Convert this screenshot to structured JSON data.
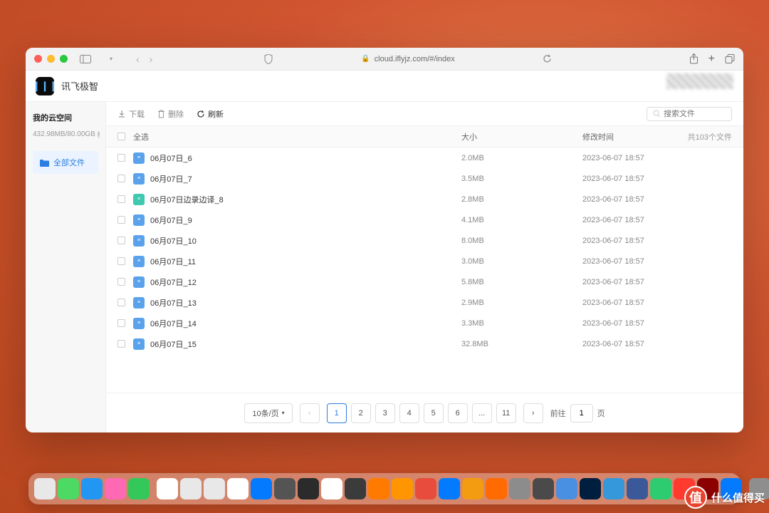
{
  "browser": {
    "url": "cloud.iflyjz.com/#/index"
  },
  "app": {
    "title": "讯飞极智"
  },
  "sidebar": {
    "title": "我的云空间",
    "storage": "432.98MB/80.00GB",
    "item_all": "全部文件"
  },
  "toolbar": {
    "download": "下载",
    "delete": "删除",
    "refresh": "刷新",
    "search_placeholder": "搜索文件"
  },
  "table": {
    "select_all": "全选",
    "size": "大小",
    "mtime": "修改时间",
    "total": "共103个文件"
  },
  "files": [
    {
      "name": "06月07日_6",
      "size": "2.0MB",
      "time": "2023-06-07 18:57",
      "alt": false
    },
    {
      "name": "06月07日_7",
      "size": "3.5MB",
      "time": "2023-06-07 18:57",
      "alt": false
    },
    {
      "name": "06月07日边录边译_8",
      "size": "2.8MB",
      "time": "2023-06-07 18:57",
      "alt": true
    },
    {
      "name": "06月07日_9",
      "size": "4.1MB",
      "time": "2023-06-07 18:57",
      "alt": false
    },
    {
      "name": "06月07日_10",
      "size": "8.0MB",
      "time": "2023-06-07 18:57",
      "alt": false
    },
    {
      "name": "06月07日_11",
      "size": "3.0MB",
      "time": "2023-06-07 18:57",
      "alt": false
    },
    {
      "name": "06月07日_12",
      "size": "5.8MB",
      "time": "2023-06-07 18:57",
      "alt": false
    },
    {
      "name": "06月07日_13",
      "size": "2.9MB",
      "time": "2023-06-07 18:57",
      "alt": false
    },
    {
      "name": "06月07日_14",
      "size": "3.3MB",
      "time": "2023-06-07 18:57",
      "alt": false
    },
    {
      "name": "06月07日_15",
      "size": "32.8MB",
      "time": "2023-06-07 18:57",
      "alt": false
    }
  ],
  "pagination": {
    "per_page": "10条/页",
    "pages": [
      "1",
      "2",
      "3",
      "4",
      "5",
      "6",
      "...",
      "11"
    ],
    "current": "1",
    "jump_label": "前往",
    "jump_value": "1",
    "jump_suffix": "页"
  },
  "dock_colors": [
    "#e8e8e8",
    "#4cd964",
    "#2196f3",
    "#ff69b4",
    "#34c759",
    "#ffffff",
    "#e8e8e8",
    "#e8e8e8",
    "#ffffff",
    "#047aff",
    "#545454",
    "#2b2b2b",
    "#ffffff",
    "#3b3b3b",
    "#ff7b00",
    "#ff9500",
    "#e74c3c",
    "#047aff",
    "#f39c12",
    "#ff6b00",
    "#8c8c8c",
    "#4a4a4a",
    "#4a90e2",
    "#001f3f",
    "#3498db",
    "#3b5998",
    "#2ecc71",
    "#ff3b30",
    "#8b0000",
    "#047aff",
    "#8e8e8e",
    "#ffffff",
    "#dcdcdc",
    "#ffffff",
    "#464646",
    "#047aff",
    "#f4f4f4",
    "#ffffff",
    "#ffffff",
    "#3b3b3b",
    "#ffffff",
    "#ffffff"
  ],
  "watermark": {
    "text": "什么值得买",
    "badge": "值"
  }
}
